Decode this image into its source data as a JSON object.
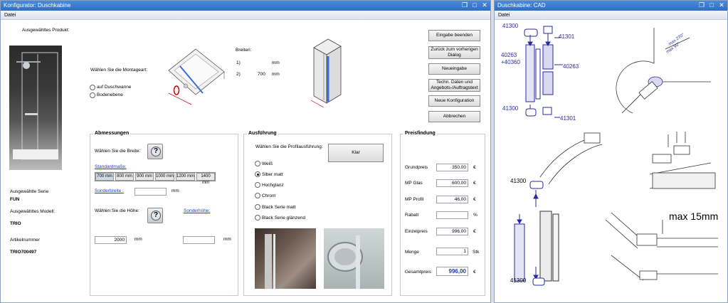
{
  "main_window": {
    "title": "Konfigurator: Duschkabine",
    "menu": [
      "Datei"
    ],
    "selected_product_label": "Ausgewähltes Produkt:",
    "series_label": "Ausgewählte Serie",
    "series_value": "FUN",
    "model_label": "Ausgewähltes Modell:",
    "model_value": "TRIO",
    "article_label": "Artikelnummer",
    "article_value": "TRIO700497",
    "mounting_label": "Wählen Sie die Montageart:",
    "mounting_options": [
      {
        "label": "auf Duschwanne",
        "selected": false
      },
      {
        "label": "Bodenebene",
        "selected": false
      }
    ],
    "widths_label": "Breiten:",
    "widths": [
      {
        "index": "1)",
        "value": "",
        "unit": "mm"
      },
      {
        "index": "2)",
        "value": "700",
        "unit": "mm"
      }
    ],
    "buttons": [
      "Eingabe beenden",
      "Zurück zum vorherigen Dialog",
      "Neueingabe",
      "Techn. Daten und Angebots-/Auftragstext",
      "Neue Konfiguration",
      "Abbrechen"
    ],
    "abmessungen": {
      "title": "Abmessungen",
      "width_label": "Wählen Sie die Breite:",
      "standard_label": "Standardmaße:",
      "standard_sizes": [
        "700 mm",
        "800 mm",
        "900 mm",
        "1000 mm",
        "1200 mm",
        "1400 mm"
      ],
      "special_width_label": "Sonderbreite :",
      "special_width_value": "",
      "special_width_unit": "mm",
      "height_label": "Wählen Sie die Höhe:",
      "special_height_label": "Sonderhöhe:",
      "height_value": "2000",
      "height_unit": "mm",
      "special_height_value": "",
      "special_height_unit": "mm"
    },
    "ausfuehrung": {
      "title": "Ausführung",
      "profile_label": "Wählen Sie die Profilausführung:",
      "glass_button": "Klar",
      "options": [
        {
          "label": "Weiß",
          "selected": false
        },
        {
          "label": "Slber matt",
          "selected": true
        },
        {
          "label": "Hochglanz",
          "selected": false
        },
        {
          "label": "Chrom",
          "selected": false
        },
        {
          "label": "Black Serie matt",
          "selected": false
        },
        {
          "label": "Black Serie glänzend",
          "selected": false
        }
      ]
    },
    "preisfindung": {
      "title": "Preisfindung",
      "rows": [
        {
          "label": "Grundpreis",
          "value": "350,00",
          "unit": "€"
        },
        {
          "label": "MP Glas",
          "value": "600,00",
          "unit": "€"
        },
        {
          "label": "MP Profil",
          "value": "46,00",
          "unit": "€"
        },
        {
          "label": "Rabatt",
          "value": "",
          "unit": "%"
        },
        {
          "label": "Einzelpreis",
          "value": "996,00",
          "unit": "€"
        },
        {
          "label": "Menge",
          "value": "1",
          "unit": "Stk"
        },
        {
          "label": "Gesamtpreis",
          "value": "996,00",
          "unit": "€"
        }
      ]
    }
  },
  "cad_window": {
    "title": "Duschkabine: CAD",
    "menu": [
      "Datei"
    ],
    "labels": [
      "41300",
      "41301",
      "40263",
      "+40360",
      "40263",
      "41300",
      "41301",
      "41300",
      "41300",
      "max 15mm",
      "max 270°",
      "max 90°"
    ]
  },
  "colors": {
    "titlebar": "#2f6ec4",
    "cad_blue": "#2a2aa0",
    "price_highlight": "#1e3fb6"
  }
}
